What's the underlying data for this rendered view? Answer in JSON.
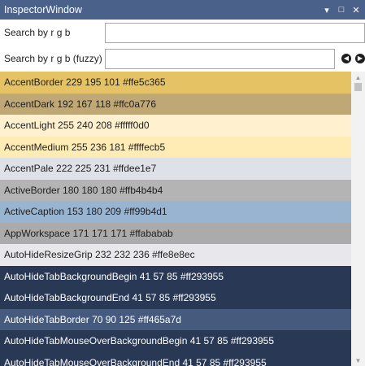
{
  "window": {
    "title": "InspectorWindow",
    "controls": {
      "dropdown": "▾",
      "maximize": "□",
      "close": "✕"
    }
  },
  "search": {
    "exact_label": "Search by r g b",
    "exact_value": "",
    "fuzzy_label": "Search by r g b (fuzzy)",
    "fuzzy_value": "",
    "prev_icon": "◀",
    "next_icon": "▶"
  },
  "list": {
    "items": [
      {
        "label": "AccentBorder 229 195 101 #ffe5c365",
        "bg": "#e5c365",
        "fg": "#1e1e1e"
      },
      {
        "label": "AccentDark 192 167 118 #ffc0a776",
        "bg": "#c0a776",
        "fg": "#1e1e1e"
      },
      {
        "label": "AccentLight 255 240 208 #fffff0d0",
        "bg": "#fff0d0",
        "fg": "#1e1e1e"
      },
      {
        "label": "AccentMedium 255 236 181 #ffffecb5",
        "bg": "#ffecb5",
        "fg": "#1e1e1e"
      },
      {
        "label": "AccentPale 222 225 231 #ffdee1e7",
        "bg": "#dee1e7",
        "fg": "#1e1e1e"
      },
      {
        "label": "ActiveBorder 180 180 180 #ffb4b4b4",
        "bg": "#b4b4b4",
        "fg": "#1e1e1e"
      },
      {
        "label": "ActiveCaption 153 180 209 #ff99b4d1",
        "bg": "#99b4d1",
        "fg": "#1e1e1e"
      },
      {
        "label": "AppWorkspace 171 171 171 #ffababab",
        "bg": "#ababab",
        "fg": "#1e1e1e"
      },
      {
        "label": "AutoHideResizeGrip 232 232 236 #ffe8e8ec",
        "bg": "#e8e8ec",
        "fg": "#1e1e1e"
      },
      {
        "label": "AutoHideTabBackgroundBegin 41 57 85 #ff293955",
        "bg": "#293955",
        "fg": "#ffffff"
      },
      {
        "label": "AutoHideTabBackgroundEnd 41 57 85 #ff293955",
        "bg": "#293955",
        "fg": "#ffffff"
      },
      {
        "label": "AutoHideTabBorder 70 90 125 #ff465a7d",
        "bg": "#465a7d",
        "fg": "#ffffff"
      },
      {
        "label": "AutoHideTabMouseOverBackgroundBegin 41 57 85 #ff293955",
        "bg": "#293955",
        "fg": "#ffffff"
      },
      {
        "label": "AutoHideTabMouseOverBackgroundEnd 41 57 85 #ff293955",
        "bg": "#293955",
        "fg": "#ffffff"
      }
    ]
  },
  "scrollbar": {
    "up_icon": "▲",
    "down_icon": "▼"
  }
}
